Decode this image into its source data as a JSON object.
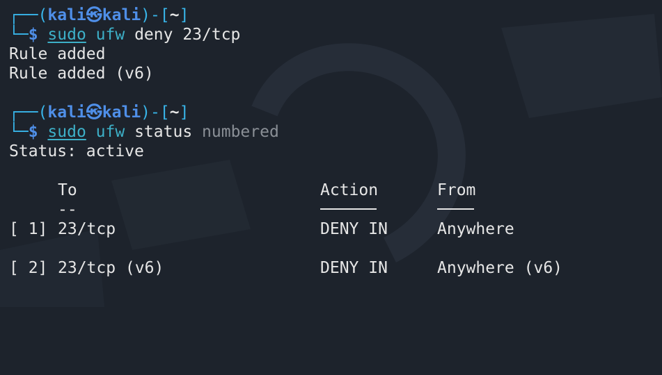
{
  "prompt": {
    "open": "┌──(",
    "user": "kali",
    "at": "㉿",
    "host": "kali",
    "mid": ")-[",
    "dir": "~",
    "close": "]",
    "corner": "└─",
    "dollar": "$"
  },
  "block1": {
    "sudo": "sudo",
    "ufw": "ufw",
    "args": "deny 23/tcp",
    "output": [
      "Rule added",
      "Rule added (v6)"
    ]
  },
  "block2": {
    "sudo": "sudo",
    "ufw": "ufw",
    "args": "status",
    "args_dim": "numbered",
    "status": "Status: active"
  },
  "table": {
    "headers": {
      "to": "To",
      "action": "Action",
      "from": "From"
    },
    "to_underline": "--",
    "rows": [
      {
        "num": "[ 1]",
        "to": "23/tcp",
        "action": "DENY IN",
        "from": "Anywhere"
      },
      {
        "num": "[ 2]",
        "to": "23/tcp (v6)",
        "action": "DENY IN",
        "from": "Anywhere (v6)"
      }
    ]
  },
  "colors": {
    "background": "#1d232c",
    "prompt_frame": "#38b4e8",
    "user_host": "#4f8fe8",
    "command": "#3db0c8",
    "text": "#e6e6e6",
    "dim": "#8a8f96"
  }
}
